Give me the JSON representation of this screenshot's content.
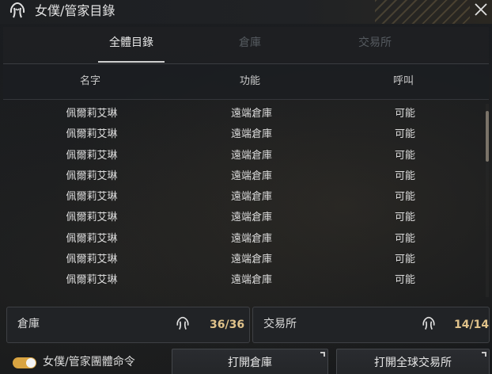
{
  "window": {
    "title": "女僕/管家目錄"
  },
  "tabs": [
    {
      "label": "全體目錄",
      "active": true
    },
    {
      "label": "倉庫",
      "active": false
    },
    {
      "label": "交易所",
      "active": false
    }
  ],
  "table": {
    "columns": [
      "名字",
      "功能",
      "呼叫"
    ],
    "rows": [
      [
        "佩爾莉艾琳",
        "遠端倉庫",
        "可能"
      ],
      [
        "佩爾莉艾琳",
        "遠端倉庫",
        "可能"
      ],
      [
        "佩爾莉艾琳",
        "遠端倉庫",
        "可能"
      ],
      [
        "佩爾莉艾琳",
        "遠端倉庫",
        "可能"
      ],
      [
        "佩爾莉艾琳",
        "遠端倉庫",
        "可能"
      ],
      [
        "佩爾莉艾琳",
        "遠端倉庫",
        "可能"
      ],
      [
        "佩爾莉艾琳",
        "遠端倉庫",
        "可能"
      ],
      [
        "佩爾莉艾琳",
        "遠端倉庫",
        "可能"
      ],
      [
        "佩爾莉艾琳",
        "遠端倉庫",
        "可能"
      ]
    ]
  },
  "summary": {
    "warehouse": {
      "label": "倉庫",
      "count": "36/36"
    },
    "market": {
      "label": "交易所",
      "count": "14/14"
    }
  },
  "footer": {
    "group_command_label": "女僕/管家團體命令",
    "group_command_on": true,
    "open_warehouse_label": "打開倉庫",
    "open_market_label": "打開全球交易所"
  },
  "colors": {
    "accent": "#d9a441",
    "count": "#e0c28a",
    "background": "#1b1d20"
  },
  "icons": {
    "title": "maid-icon",
    "close": "close-icon",
    "panel": "maid-icon",
    "button_corner": "expand-corner-icon"
  }
}
